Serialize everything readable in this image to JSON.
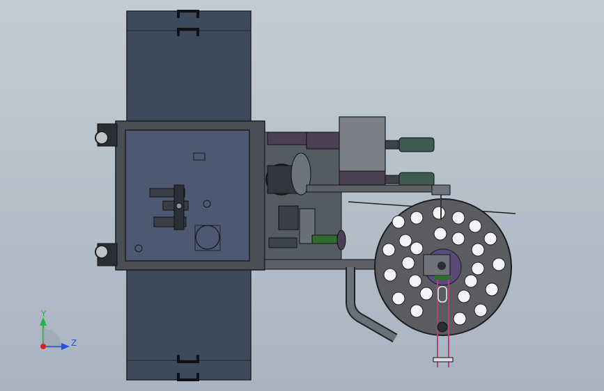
{
  "viewport": {
    "background_top": "#c3ccd6",
    "background_bottom": "#a9b4c1"
  },
  "model_colors": {
    "panel_dark": "#3c4a5c",
    "frame": "#4a4f55",
    "plate": "#4d5872",
    "disc": "#5a5c60",
    "motor": "#4a3f55",
    "green_part": "#2f6d2f",
    "pink_part": "#b0447a",
    "box": "#7b7f86",
    "roller": "#3e5a52"
  },
  "triad": {
    "y_label": "Y",
    "z_label": "Z",
    "y_color": "#2bb24a",
    "z_color": "#2a4fd6",
    "origin_color": "#d42020"
  }
}
